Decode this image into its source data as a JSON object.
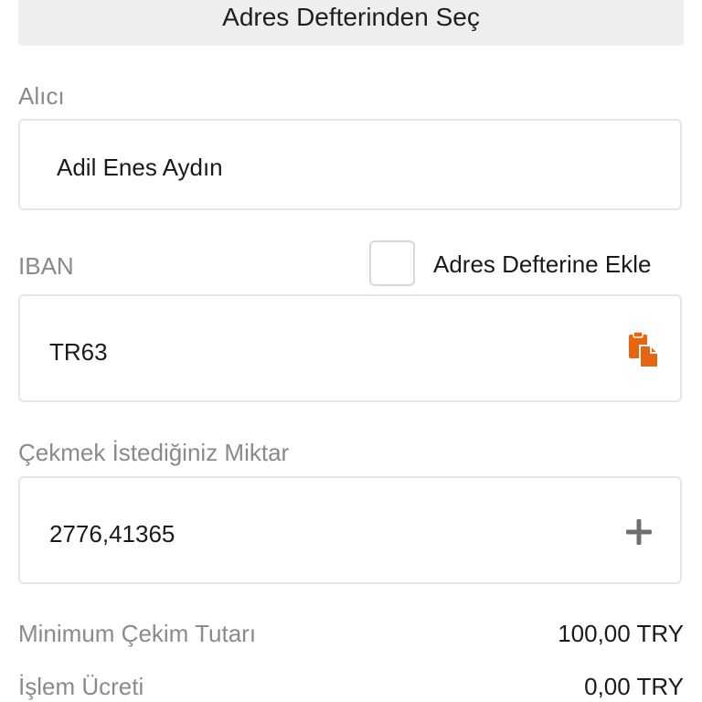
{
  "address_book_button": {
    "label": "Adres Defterinden Seç"
  },
  "recipient": {
    "label": "Alıcı",
    "value": "Adil Enes Aydın"
  },
  "iban": {
    "label": "IBAN",
    "value": "TR63 ",
    "add_to_book_label": "Adres Defterine Ekle",
    "add_to_book_checked": false,
    "paste_icon": "paste-icon",
    "accent_color": "#e8650f"
  },
  "amount": {
    "label": "Çekmek İstediğiniz Miktar",
    "value": "2776,41365",
    "plus_icon": "plus-icon"
  },
  "summary": {
    "min_label": "Minimum Çekim Tutarı",
    "min_value": "100,00 TRY",
    "fee_label": "İşlem Ücreti",
    "fee_value": "0,00 TRY"
  }
}
